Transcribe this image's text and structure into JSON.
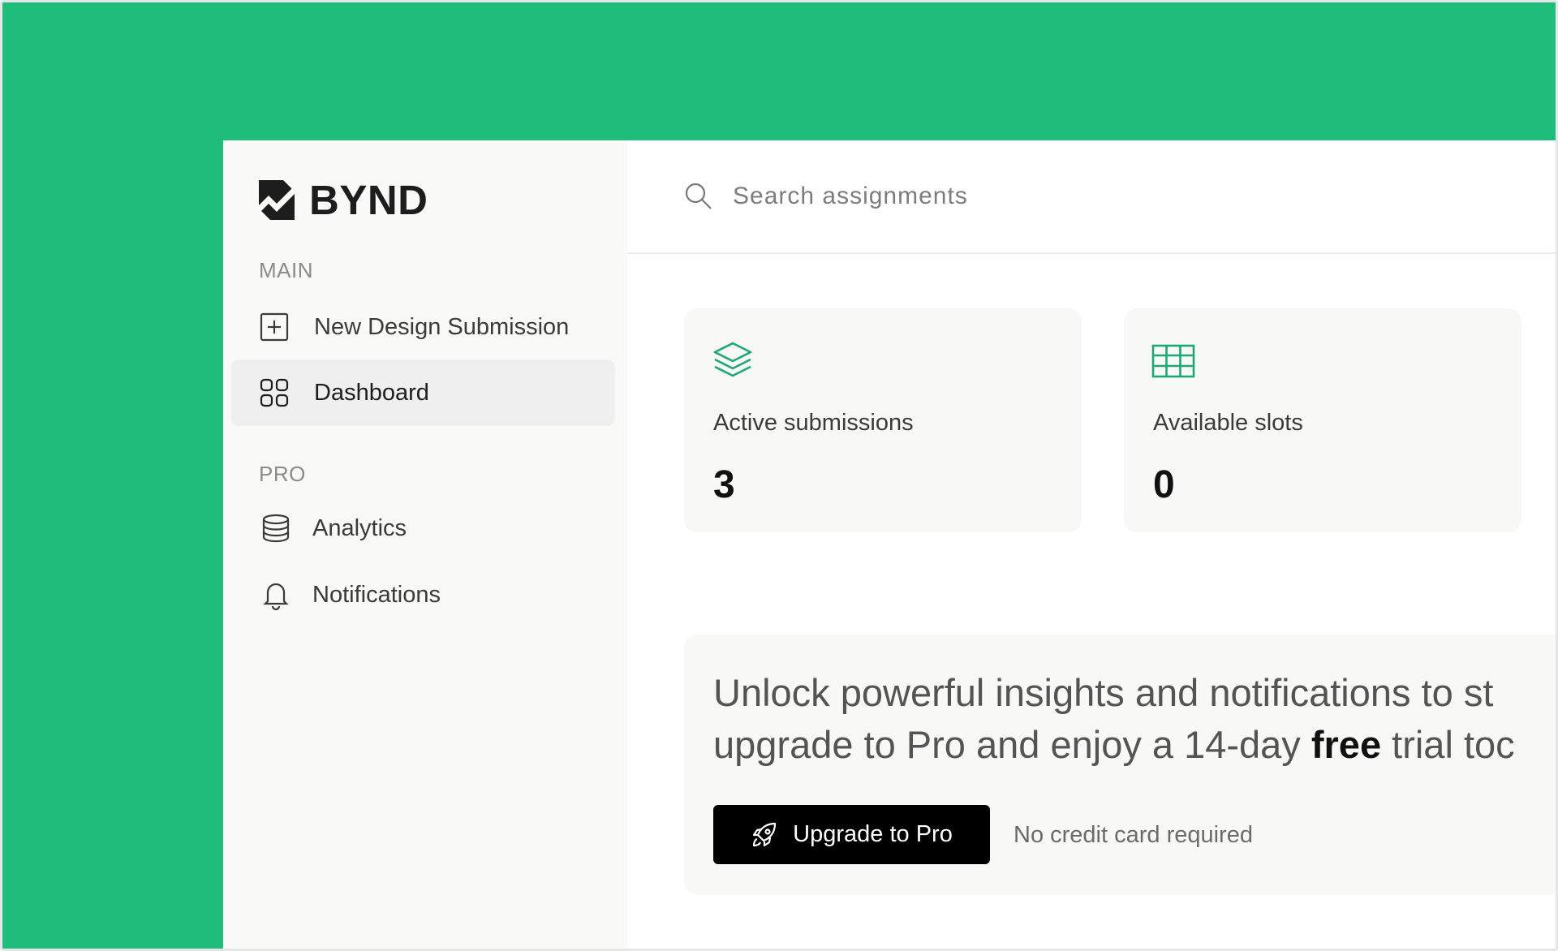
{
  "colors": {
    "brand_green": "#1fbd7b",
    "accent_icon": "#1fa876"
  },
  "sidebar": {
    "logo_text": "BYND",
    "sections": [
      {
        "label": "MAIN",
        "items": [
          {
            "label": "New Design Submission",
            "icon": "plus-square-icon",
            "active": false
          },
          {
            "label": "Dashboard",
            "icon": "grid-icon",
            "active": true
          }
        ]
      },
      {
        "label": "PRO",
        "items": [
          {
            "label": "Analytics",
            "icon": "database-icon",
            "active": false
          },
          {
            "label": "Notifications",
            "icon": "bell-icon",
            "active": false
          }
        ]
      }
    ]
  },
  "search": {
    "placeholder": "Search assignments"
  },
  "stats": [
    {
      "label": "Active submissions",
      "value": "3",
      "icon": "layers-icon"
    },
    {
      "label": "Available slots",
      "value": "0",
      "icon": "table-icon"
    }
  ],
  "promo": {
    "line1": "Unlock powerful insights and notifications to st",
    "line2_before": "upgrade to Pro and enjoy a 14-day ",
    "line2_bold": "free",
    "line2_after": " trial toc",
    "button_label": "Upgrade to Pro",
    "note": "No credit card required"
  }
}
